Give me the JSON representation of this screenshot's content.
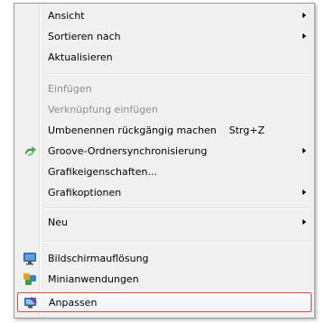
{
  "menu": {
    "items": [
      {
        "label": "Ansicht",
        "submenu": true
      },
      {
        "label": "Sortieren nach",
        "submenu": true
      },
      {
        "label": "Aktualisieren"
      },
      {
        "label": "Einfügen",
        "disabled": true
      },
      {
        "label": "Verknüpfung einfügen",
        "disabled": true
      },
      {
        "label": "Umbenennen rückgängig machen",
        "shortcut": "Strg+Z"
      },
      {
        "label": "Groove-Ordnersynchronisierung",
        "submenu": true,
        "icon": "groove-sync-icon"
      },
      {
        "label": "Grafikeigenschaften..."
      },
      {
        "label": "Grafikoptionen",
        "submenu": true
      },
      {
        "label": "Neu",
        "submenu": true
      },
      {
        "label": "Bildschirmauflösung",
        "icon": "monitor-icon"
      },
      {
        "label": "Minianwendungen",
        "icon": "gadgets-icon"
      },
      {
        "label": "Anpassen",
        "icon": "personalize-icon",
        "highlighted": true
      }
    ]
  },
  "colors": {
    "menu_bg": "#f0f0f0",
    "disabled_text": "#8d8d8d",
    "highlight_border": "#e6463c"
  }
}
